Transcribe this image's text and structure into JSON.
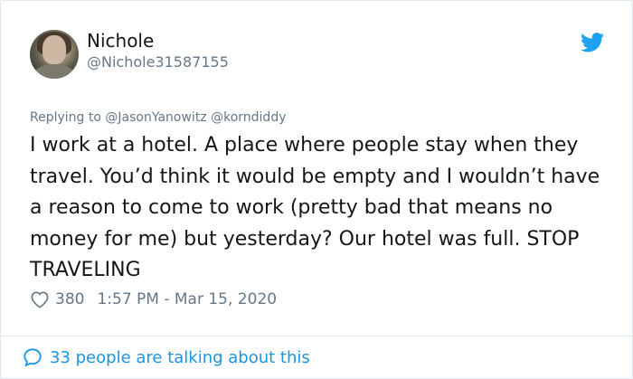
{
  "author": {
    "name": "Nichole",
    "handle": "@Nichole31587155"
  },
  "reply": {
    "prefix": "Replying to ",
    "mentions": "@JasonYanowitz @korndiddy"
  },
  "tweet": {
    "text": "I work at a hotel. A place where people stay when they travel. You’d think it would be empty and I wouldn’t have a reason to come to work (pretty bad that means no money for me) but yesterday? Our hotel was full. STOP TRAVELING",
    "likes": "380",
    "timestamp": "1:57 PM - Mar 15, 2020"
  },
  "footer": {
    "conversation": "33 people are talking about this"
  },
  "icons": {
    "brand": "twitter-bird-icon",
    "like": "heart-icon",
    "conversation": "speech-bubble-icon"
  },
  "colors": {
    "twitter_blue": "#1da1f2",
    "link_blue": "#1b95e0",
    "text": "#14171a",
    "muted": "#657786",
    "border": "#e1e8ed"
  }
}
